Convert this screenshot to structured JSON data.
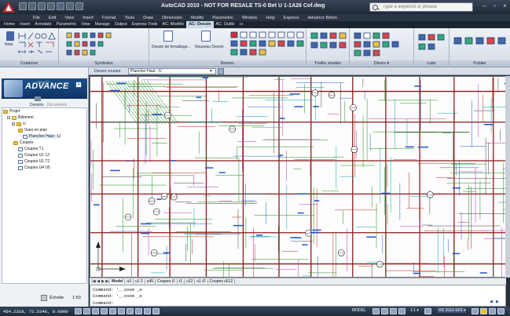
{
  "title_bar": {
    "title": "AutoCAD 2010 - NOT FOR RESALE   TS-0 Bet U 1-1A26 Cof.dwg",
    "search_placeholder": "Type a keyword or phrase"
  },
  "menu": [
    "File",
    "Edit",
    "View",
    "Insert",
    "Format",
    "Tools",
    "Draw",
    "Dimension",
    "Modify",
    "Parametric",
    "Window",
    "Help",
    "Express",
    "Advance Béton"
  ],
  "ribbon_tabs": [
    {
      "label": "Home",
      "active": false
    },
    {
      "label": "Insert",
      "active": false
    },
    {
      "label": "Annotate",
      "active": false
    },
    {
      "label": "Parametric",
      "active": false
    },
    {
      "label": "View",
      "active": false
    },
    {
      "label": "Manage",
      "active": false
    },
    {
      "label": "Output",
      "active": false
    },
    {
      "label": "Express Tools",
      "active": false
    },
    {
      "label": "AC: Modèle",
      "active": false
    },
    {
      "label": "AC: Dessin",
      "active": true
    },
    {
      "label": "AC: Outils",
      "active": false
    }
  ],
  "ribbon_panels": {
    "cotations": "Cotations",
    "symboles": "Symboles",
    "bornes": "Bornes",
    "treillis": "Treillis soudés",
    "divers": "Divers ▾",
    "liste": "Liste",
    "publier": "Publier",
    "note_btn": "Note",
    "dessin_ferraillage": "Dessin de ferraillage...",
    "nouveau_dessin": "Nouveau Dessin"
  },
  "palette": {
    "brand_title": "ADVANCE",
    "brand_sub": "GRAITEC",
    "tab_dessins": "Dessins",
    "tab_documents": "Documents",
    "tree": [
      {
        "label": "Projet",
        "level": 0,
        "type": "folder"
      },
      {
        "label": "Bâtiment",
        "level": 1,
        "type": "build"
      },
      {
        "label": "U",
        "level": 2,
        "type": "folder"
      },
      {
        "label": "Vues en plan",
        "level": 3,
        "type": "folder"
      },
      {
        "label": "Plancher Haut - U",
        "level": 4,
        "type": "doc"
      },
      {
        "label": "Coupes",
        "level": 2,
        "type": "folder"
      },
      {
        "label": "Coupes T1",
        "level": 3,
        "type": "doc"
      },
      {
        "label": "Coupes U1 12",
        "level": 3,
        "type": "doc"
      },
      {
        "label": "Coupes U1 T2",
        "level": 3,
        "type": "doc"
      },
      {
        "label": "Coupes U4 U5",
        "level": 3,
        "type": "doc"
      }
    ],
    "scale_label": "Échelle",
    "scale_value": "1:50"
  },
  "drawing": {
    "layer_label": "Dessin courant",
    "layer_value": "Plancher Haut - U",
    "layout_tabs": [
      {
        "label": "Model",
        "active": true
      },
      {
        "label": "u3",
        "active": false
      },
      {
        "label": "u1 2",
        "active": false
      },
      {
        "label": "u45",
        "active": false
      },
      {
        "label": "Coupes t1",
        "active": false
      },
      {
        "label": "t1",
        "active": false
      },
      {
        "label": "u12",
        "active": false
      },
      {
        "label": "u1 t2",
        "active": false
      },
      {
        "label": "Coupes u512",
        "active": false
      }
    ],
    "command_lines": [
      "Command:  '_.zoom _e",
      "Command:  '_.zoom _e",
      "Command:"
    ]
  },
  "status_bar": {
    "coords": "454.2318, 71.5346, 0.0000",
    "model_label": "MODEL",
    "scale": "1:1 ▾",
    "workspace": "HD 2010 SP2 ▾"
  },
  "colors": {
    "title_bg": "#1f2835",
    "ribbon_bg": "#e2e8f0",
    "canvas_bg": "#fdfdfd",
    "gadvance_blue": "#103463"
  }
}
